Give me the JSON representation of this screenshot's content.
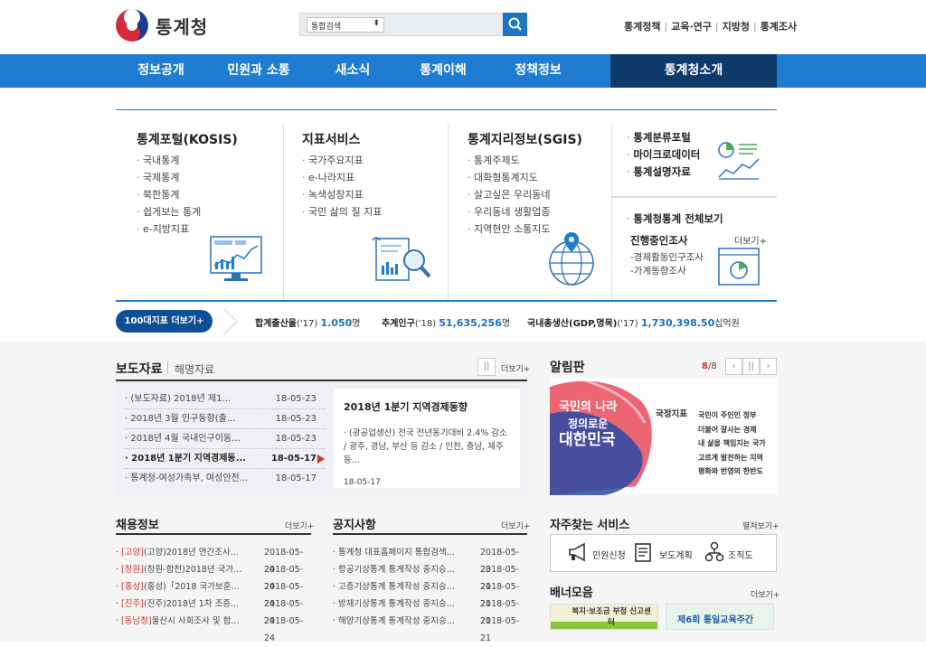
{
  "header": {
    "logo_text": "통계청",
    "search_scope": "통합검색",
    "util_links": [
      "통계정책",
      "교육·연구",
      "지방청",
      "통계조사"
    ]
  },
  "nav": {
    "items": [
      "정보공개",
      "민원과 소통",
      "새소식",
      "통계이해",
      "정책정보",
      "통계청소개"
    ],
    "active_color": "#0b3a6b",
    "bar_color": "#1e7dd2"
  },
  "mega": {
    "col1": {
      "title": "통계포털(KOSIS)",
      "items": [
        "국내통계",
        "국제통계",
        "북한통계",
        "쉽게보는 통계",
        "e-지방지표"
      ]
    },
    "col2": {
      "title": "지표서비스",
      "items": [
        "국가주요지표",
        "e-나라지표",
        "녹색성장지표",
        "국민 삶의 질 지표"
      ]
    },
    "col3": {
      "title": "통계지리정보(SGIS)",
      "items": [
        "통계주제도",
        "대화형통계지도",
        "살고싶은 우리동네",
        "우리동네 생활업종",
        "지역현안 소통지도"
      ]
    },
    "col4_top": [
      "통계분류포털",
      "마이크로데이터",
      "통계설명자료"
    ],
    "col4_bottom": {
      "title": "통계청통계 전체보기",
      "subtitle": "진행중인조사",
      "more": "더보기+",
      "items": [
        "경제활동인구조사",
        "가계동향조사"
      ]
    }
  },
  "stats": {
    "button": "100대지표 더보기+",
    "items": [
      {
        "label": "합계출산율",
        "year": "('17)",
        "value": "1.050",
        "unit": "명"
      },
      {
        "label": "추계인구",
        "year": "('18)",
        "value": "51,635,256",
        "unit": "명"
      },
      {
        "label": "국내총생산(GDP,명목)",
        "year": "('17)",
        "value": "1,730,398.50",
        "unit": "십억원"
      }
    ]
  },
  "press": {
    "tab_active": "보도자료",
    "tab_other": "해명자료",
    "more": "더보기+",
    "pause": "||",
    "rows": [
      {
        "title": "(보도자료) 2018년 제1...",
        "date": "18-05-23"
      },
      {
        "title": "2018년 3월 인구동향(출...",
        "date": "18-05-23"
      },
      {
        "title": "2018년 4월 국내인구이동...",
        "date": "18-05-23"
      },
      {
        "title": "2018년 1분기 지역경제동...",
        "date": "18-05-17"
      },
      {
        "title": "통계청-여성가족부, 여성안전...",
        "date": "18-05-17"
      }
    ],
    "detail": {
      "title": "2018년 1분기 지역경제동향",
      "body": "· (광공업생산) 전국 전년동기대비 2.4% 감소 / 광주, 경남, 부산 등 감소 / 인천, 충남, 제주 등...",
      "date": "18-05-17"
    }
  },
  "notice": {
    "title": "알림판",
    "page_current": "8",
    "page_total": "/8",
    "banner": {
      "slogan_line1": "국민의 나라",
      "slogan_line2": "정의로운",
      "slogan_line3": "대한민국",
      "label": "국정지표",
      "lines": [
        "국민이 주인인 정부",
        "더불어 잘사는 경제",
        "내 삶을 책임지는 국가",
        "고르게 발전하는 지역",
        "평화와 번영의 한반도"
      ]
    }
  },
  "recruit": {
    "title": "채용정보",
    "more": "더보기+",
    "rows": [
      {
        "tag": "[고양]",
        "title": "(고양)2018년 연간조사...",
        "date": "2018-05-24"
      },
      {
        "tag": "[창원]",
        "title": "(창원-합천)2018년 국가...",
        "date": "2018-05-24"
      },
      {
        "tag": "[홍성]",
        "title": "(홍성)「2018 국가보훈...",
        "date": "2018-05-24"
      },
      {
        "tag": "[진주]",
        "title": "(진주)2018년 1차 조증...",
        "date": "2018-05-24"
      },
      {
        "tag": "[동남청]",
        "title": "울산시 사회조사 및 합...",
        "date": "2018-05-24"
      }
    ]
  },
  "announce": {
    "title": "공지사항",
    "more": "더보기+",
    "rows": [
      {
        "title": "통계청 대표홈페이지 통합검색...",
        "date": "2018-05-23"
      },
      {
        "title": "항공기상통계 통계작성 중지승...",
        "date": "2018-05-21"
      },
      {
        "title": "고층기상통계 통계작성 중지승...",
        "date": "2018-05-21"
      },
      {
        "title": "방재기상통계 통계작성 중지승...",
        "date": "2018-05-21"
      },
      {
        "title": "해양기상통계 통계작성 중지승...",
        "date": "2018-05-21"
      }
    ]
  },
  "services": {
    "title": "자주찾는 서비스",
    "more": "펼쳐보기+",
    "items": [
      {
        "icon": "megaphone-icon",
        "label": "민원신청"
      },
      {
        "icon": "document-icon",
        "label": "보도계획"
      },
      {
        "icon": "org-chart-icon",
        "label": "조직도"
      }
    ]
  },
  "banners": {
    "title": "배너모음",
    "more": "더보기+",
    "items": [
      "복지·보조금 부정 신고센터",
      "제6회 통일교육주간"
    ]
  }
}
